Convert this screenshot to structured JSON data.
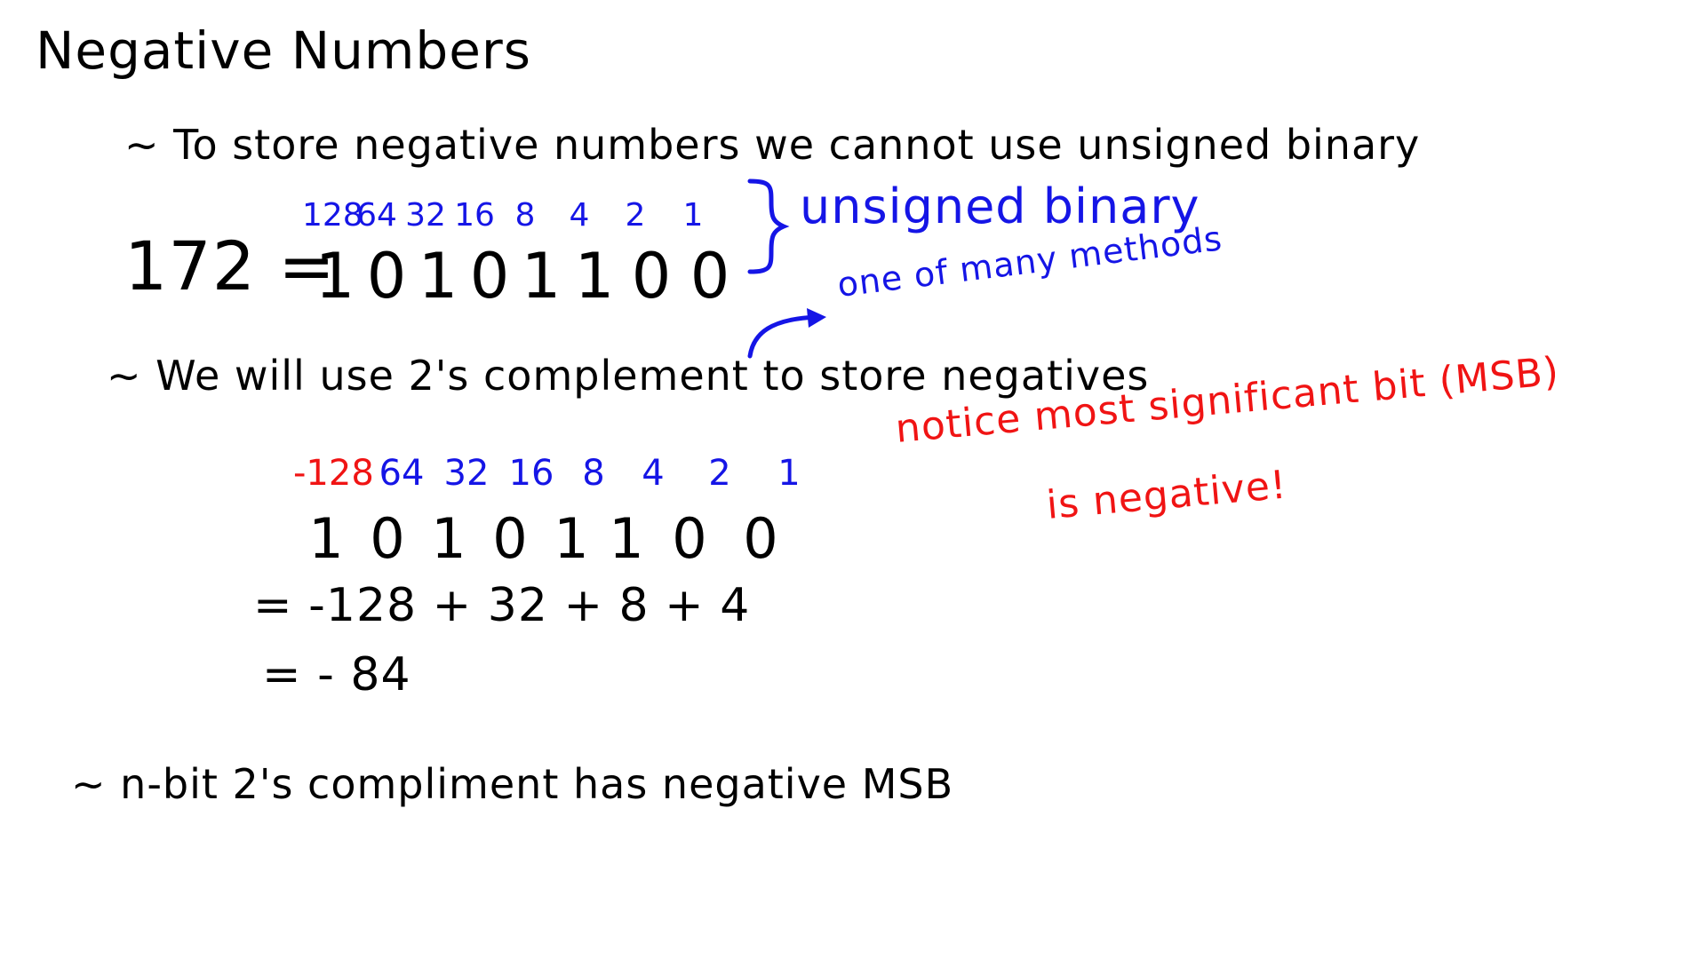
{
  "title": "Negative Numbers",
  "bullets": {
    "b1": "~ To store negative numbers we cannot use unsigned binary",
    "b2": "~ We will use 2's complement to store negatives",
    "b3": "~ n-bit 2's compliment has negative MSB"
  },
  "unsigned_example": {
    "weights": [
      "128",
      "64",
      "32",
      "16",
      "8",
      "4",
      "2",
      "1"
    ],
    "label": "172 =",
    "bits": [
      "1",
      "0",
      "1",
      "0",
      "1",
      "1",
      "0",
      "0"
    ],
    "note": "unsigned binary"
  },
  "annotations": {
    "one_of_many": "one of many methods",
    "notice_line1": "notice most significant bit (MSB)",
    "notice_line2": "is negative!"
  },
  "twos_example": {
    "msb_weight": "-128",
    "weights": [
      "64",
      "32",
      "16",
      "8",
      "4",
      "2",
      "1"
    ],
    "bits": [
      "1",
      "0",
      "1",
      "0",
      "1",
      "1",
      "0",
      "0"
    ],
    "calc_line1": "= -128 + 32 + 8 + 4",
    "calc_line2": "= - 84"
  },
  "colors": {
    "ink": "#000000",
    "blue": "#1515e6",
    "red": "#f01414"
  }
}
